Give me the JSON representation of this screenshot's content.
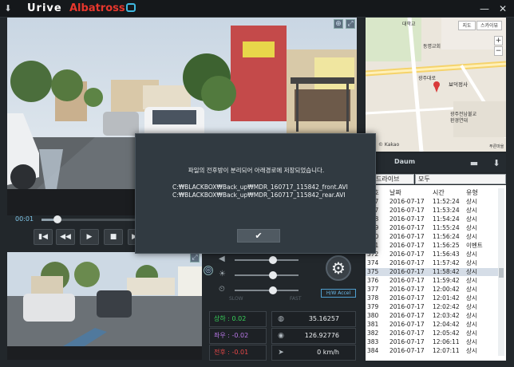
{
  "titlebar": {
    "brand": "Urive",
    "product": "Albatross",
    "close_symbol": "✕",
    "minimize_symbol": "—",
    "menu_symbol": "⬇"
  },
  "playback": {
    "time": "00:01",
    "progress_fraction": 0.05
  },
  "sensor": {
    "up_down": "상하 : 0.02",
    "left_right": "좌우 : -0.02",
    "front_back": "전후 : -0.01",
    "colors": {
      "green": "#38d05a",
      "purple": "#b877e6",
      "red": "#e84848"
    }
  },
  "gps": {
    "latitude": "35.16257",
    "longitude": "126.92776",
    "speed": "0 km/h"
  },
  "hw_accel": "H/W Accel",
  "sliders": {
    "slow_label": "SLOW",
    "fast_label": "FAST",
    "volume_level": 0.6,
    "brightness_level": 0.6,
    "speed_level": 0.6
  },
  "map": {
    "tab_map": "지도",
    "tab_skyview": "스카이뷰",
    "zoom_plus": "+",
    "zoom_minus": "−",
    "kakao": "© Kakao",
    "labels": [
      "대학교",
      "광주대로",
      "동명교회",
      "보덕정사",
      "광주전남불교\n환경연대",
      "푸른마을"
    ]
  },
  "list": {
    "daum": "Daum",
    "filter_left": "드라이브",
    "filter_right": "모두",
    "headers": [
      "번호",
      "날짜",
      "시간",
      "유형"
    ],
    "rows": [
      [
        "377",
        "2016-07-17",
        "11:52:24",
        "상시"
      ],
      [
        "367",
        "2016-07-17",
        "11:53:24",
        "상시"
      ],
      [
        "368",
        "2016-07-17",
        "11:54:24",
        "상시"
      ],
      [
        "369",
        "2016-07-17",
        "11:55:24",
        "상시"
      ],
      [
        "370",
        "2016-07-17",
        "11:56:24",
        "상시"
      ],
      [
        "371",
        "2016-07-17",
        "11:56:25",
        "이벤트"
      ],
      [
        "372",
        "2016-07-17",
        "11:56:43",
        "상시"
      ],
      [
        "374",
        "2016-07-17",
        "11:57:42",
        "상시"
      ],
      [
        "375",
        "2016-07-17",
        "11:58:42",
        "상시"
      ],
      [
        "376",
        "2016-07-17",
        "11:59:42",
        "상시"
      ],
      [
        "377",
        "2016-07-17",
        "12:00:42",
        "상시"
      ],
      [
        "378",
        "2016-07-17",
        "12:01:42",
        "상시"
      ],
      [
        "379",
        "2016-07-17",
        "12:02:42",
        "상시"
      ],
      [
        "380",
        "2016-07-17",
        "12:03:42",
        "상시"
      ],
      [
        "381",
        "2016-07-17",
        "12:04:42",
        "상시"
      ],
      [
        "382",
        "2016-07-17",
        "12:05:42",
        "상시"
      ],
      [
        "383",
        "2016-07-17",
        "12:06:11",
        "상시"
      ],
      [
        "384",
        "2016-07-17",
        "12:07:11",
        "상시"
      ]
    ],
    "selected_index": 8
  },
  "dialog": {
    "message": "파일의 전후방이 분리되어 아래경로에 저장되었습니다.",
    "path_front": "C:₩BLACKBOX₩Back_up₩MDR_160717_115842_front.AVI",
    "path_rear": "C:₩BLACKBOX₩Back_up₩MDR_160717_115842_rear.AVI",
    "ok_symbol": "✔"
  }
}
